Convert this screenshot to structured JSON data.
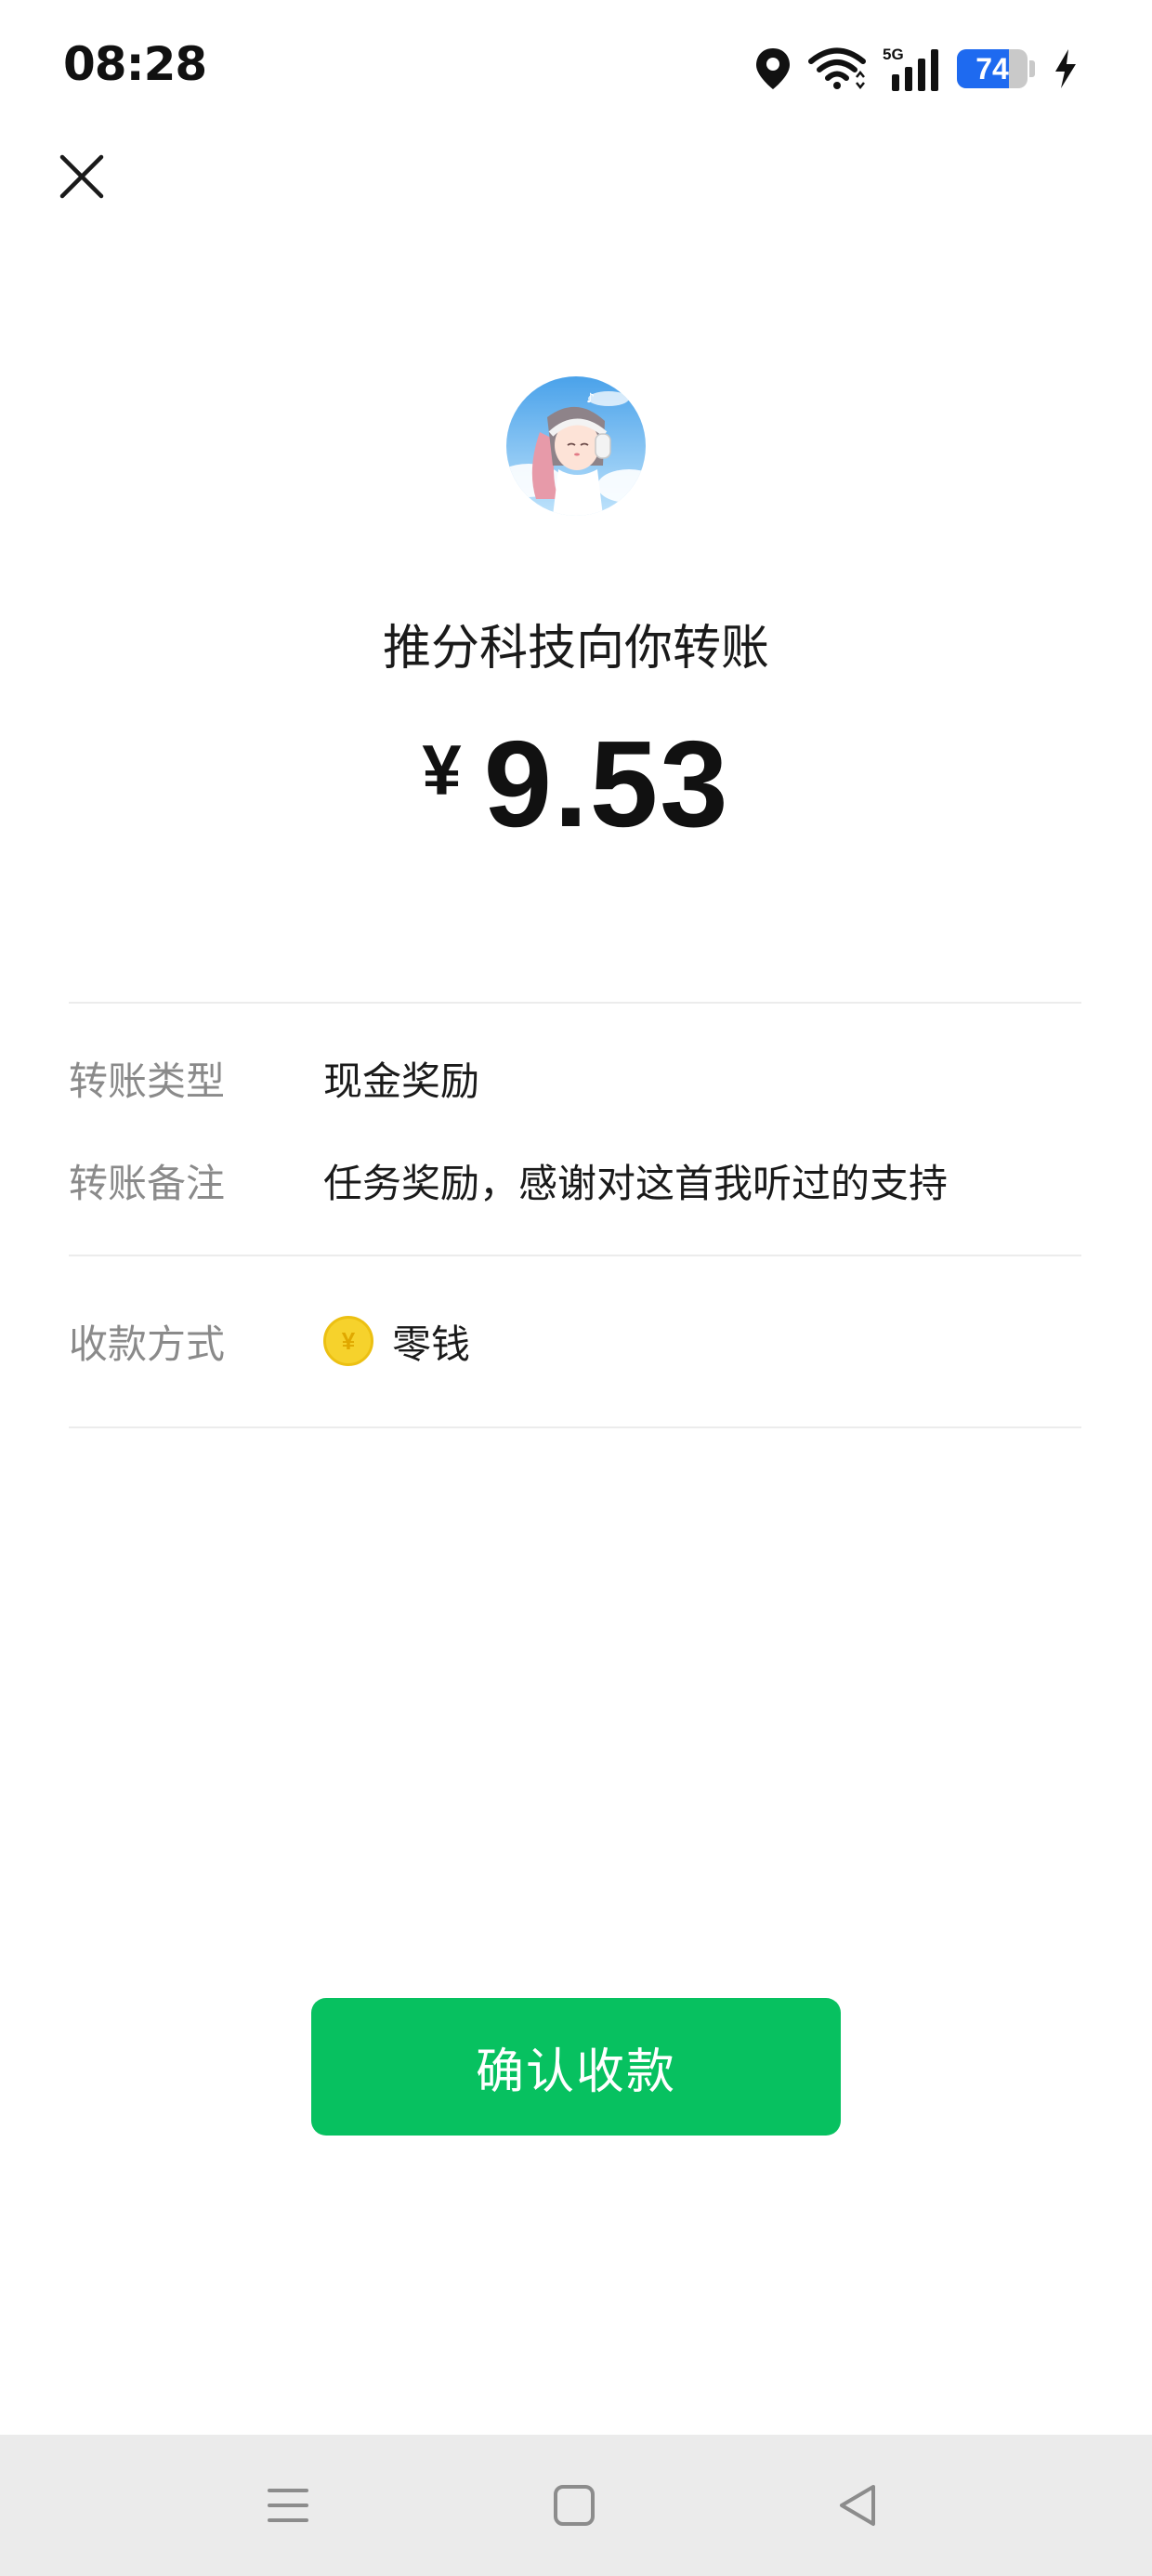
{
  "status_bar": {
    "time": "08:28",
    "network": "5G",
    "battery": "74",
    "icons": [
      "location-icon",
      "wifi-icon",
      "signal-icon",
      "battery-icon",
      "charging-icon"
    ]
  },
  "header": {
    "close_icon": "close-icon",
    "avatar": "avatar",
    "sender_text": "推分科技向你转账",
    "currency_symbol": "¥",
    "amount": "9.53"
  },
  "details": {
    "type_label": "转账类型",
    "type_value": "现金奖励",
    "note_label": "转账备注",
    "note_value": "任务奖励，感谢对这首我听过的支持",
    "method_label": "收款方式",
    "method_icon_symbol": "¥",
    "method_value": "零钱"
  },
  "actions": {
    "confirm_label": "确认收款",
    "confirm_color": "#07c160"
  },
  "nav_bar": {
    "icons": [
      "menu-icon",
      "home-icon",
      "back-icon"
    ]
  }
}
